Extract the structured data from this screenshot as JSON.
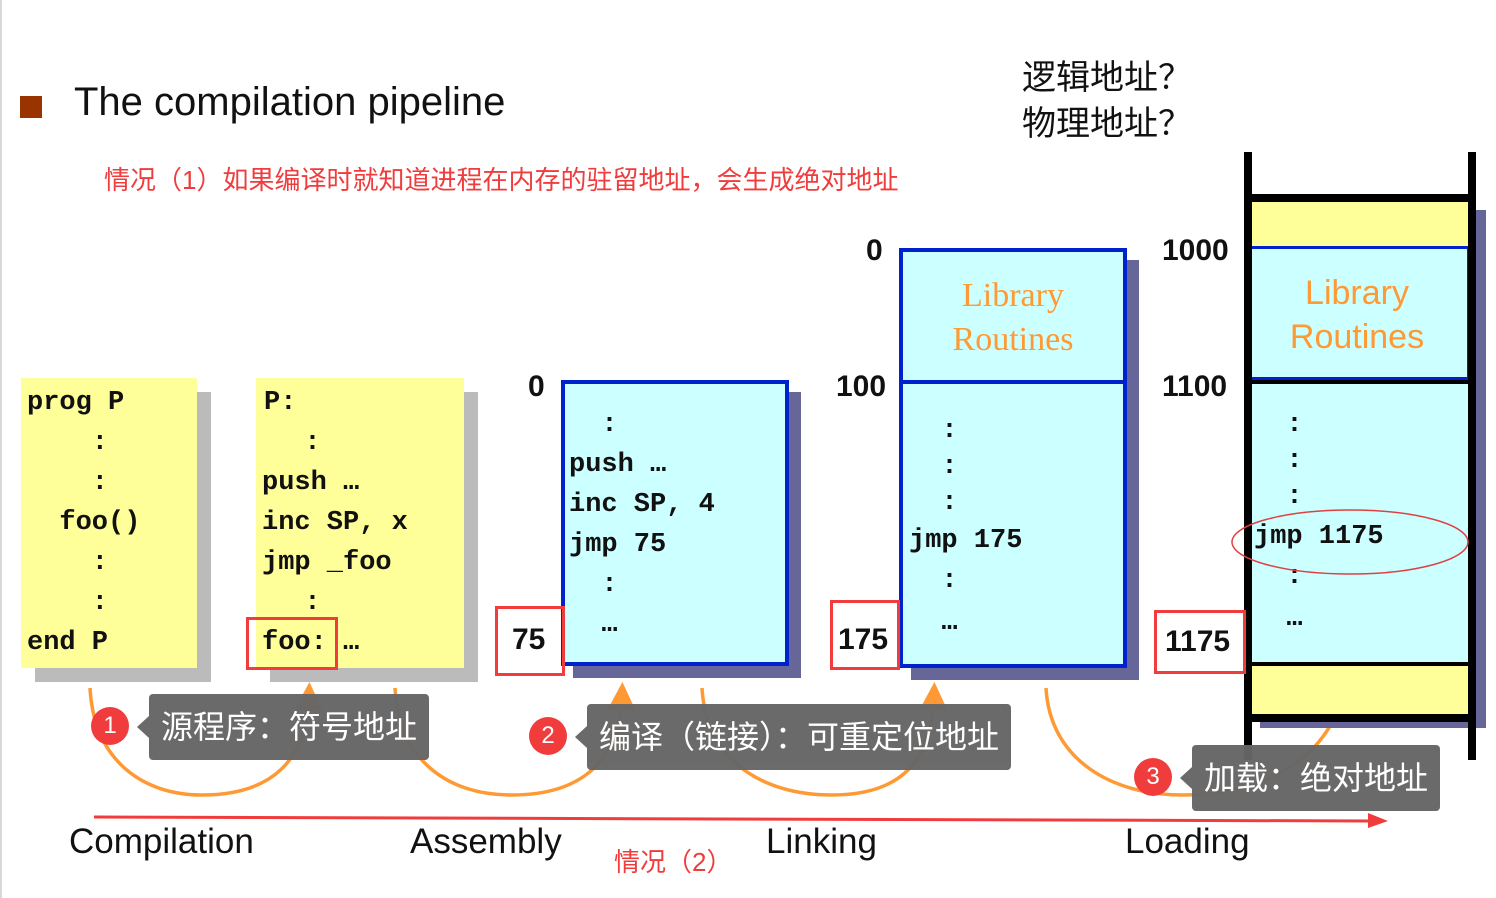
{
  "header": {
    "title": "The compilation pipeline",
    "questions": [
      "逻辑地址？",
      "物理地址？"
    ],
    "case1_note": "情况（1）如果编译时就知道进程在内存的驻留地址，会生成绝对地址",
    "case2_note": "情况（2）"
  },
  "colors": {
    "bullet": "#993300",
    "note_red": "#f03c3c",
    "code_bg": "#ffff99",
    "memory_bg": "#ccffff",
    "memory_border": "#0022cc",
    "library_text": "#ff9933",
    "arrow_orange": "#ff9933",
    "tooltip_bg": "#666666"
  },
  "source_program": {
    "lines": [
      "prog P",
      "    :",
      "    :",
      "  foo()",
      "    :",
      "    :",
      "end P"
    ]
  },
  "assembly": {
    "lines": [
      "P:",
      "  :",
      "push …",
      "inc SP, x",
      "jmp _foo",
      "  :",
      "foo: …"
    ]
  },
  "object_module": {
    "start_addr": "0",
    "highlight_addr": "75",
    "lines": [
      "  :",
      "push …",
      "inc SP, 4",
      "jmp 75",
      "  :",
      "  …"
    ]
  },
  "linked_module": {
    "start_addr": "0",
    "lib_end_addr": "100",
    "highlight_addr": "175",
    "library_label": [
      "Library",
      "Routines"
    ],
    "lines": [
      "  :",
      "  :",
      "  :",
      "jmp 175",
      "  :",
      "  …"
    ]
  },
  "loaded_memory": {
    "start_addr": "1000",
    "lib_end_addr": "1100",
    "highlight_addr": "1175",
    "library_label": [
      "Library",
      "Routines"
    ],
    "lines": [
      "  :",
      "  :",
      "  :",
      "jmp 1175",
      "  :",
      "  …"
    ]
  },
  "annotations": [
    {
      "number": "1",
      "text": "源程序：符号地址"
    },
    {
      "number": "2",
      "text": "编译（链接）：可重定位地址"
    },
    {
      "number": "3",
      "text": "加载：绝对地址"
    }
  ],
  "stages": [
    "Compilation",
    "Assembly",
    "Linking",
    "Loading"
  ]
}
